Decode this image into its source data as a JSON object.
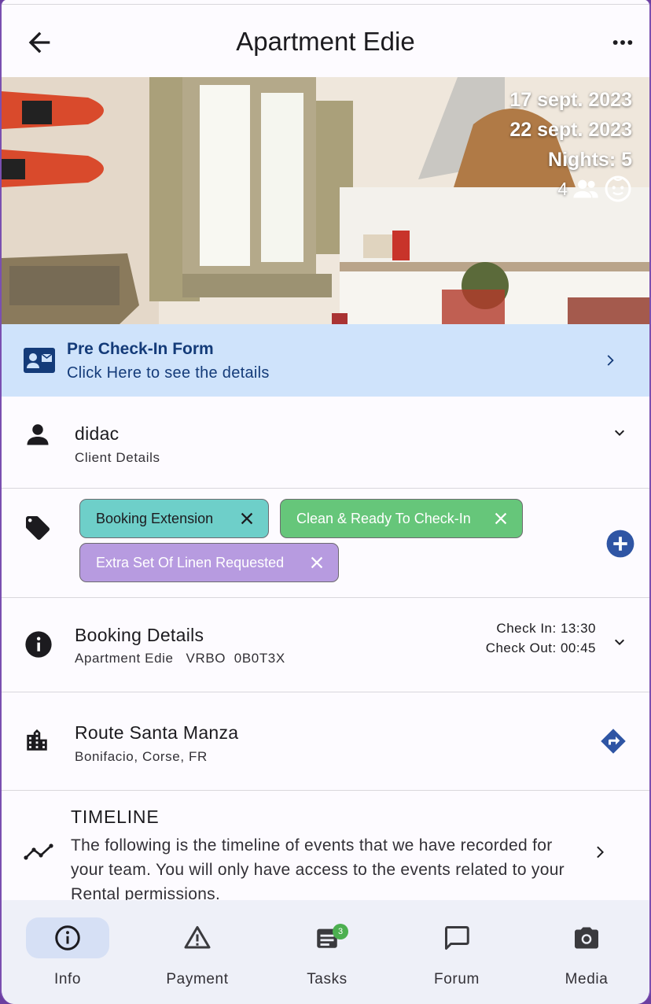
{
  "appbar": {
    "title": "Apartment Edie"
  },
  "hero": {
    "check_in_date": "17 sept. 2023",
    "check_out_date": "22 sept. 2023",
    "nights": "Nights: 5",
    "guests_count": "4"
  },
  "precheck": {
    "title": "Pre Check-In Form",
    "subtitle": "Click Here to see the details"
  },
  "client": {
    "name": "didac",
    "label": "Client Details"
  },
  "tags": [
    {
      "label": "Booking Extension",
      "color": "#6ecfc9"
    },
    {
      "label": "Clean & Ready To Check-In",
      "color": "#66c67a"
    },
    {
      "label": "Extra Set Of Linen Requested",
      "color": "#b79be0"
    }
  ],
  "booking": {
    "title": "Booking Details",
    "subtitle": "Apartment Edie   VRBO  0B0T3X",
    "check_in": "Check In: 13:30",
    "check_out": "Check Out: 00:45"
  },
  "address": {
    "street": "Route Santa Manza",
    "city": "Bonifacio, Corse, FR"
  },
  "timeline": {
    "title": "TIMELINE",
    "text": "The following is the timeline of events that we have recorded for your team. You will only have access to the events related to your Rental permissions."
  },
  "bottomnav": {
    "items": [
      {
        "label": "Info"
      },
      {
        "label": "Payment"
      },
      {
        "label": "Tasks",
        "badge": "3"
      },
      {
        "label": "Forum"
      },
      {
        "label": "Media"
      }
    ]
  },
  "colors": {
    "accent": "#2f55a4",
    "banner": "#cfe3fb",
    "nav_bg": "#eef0f8"
  }
}
